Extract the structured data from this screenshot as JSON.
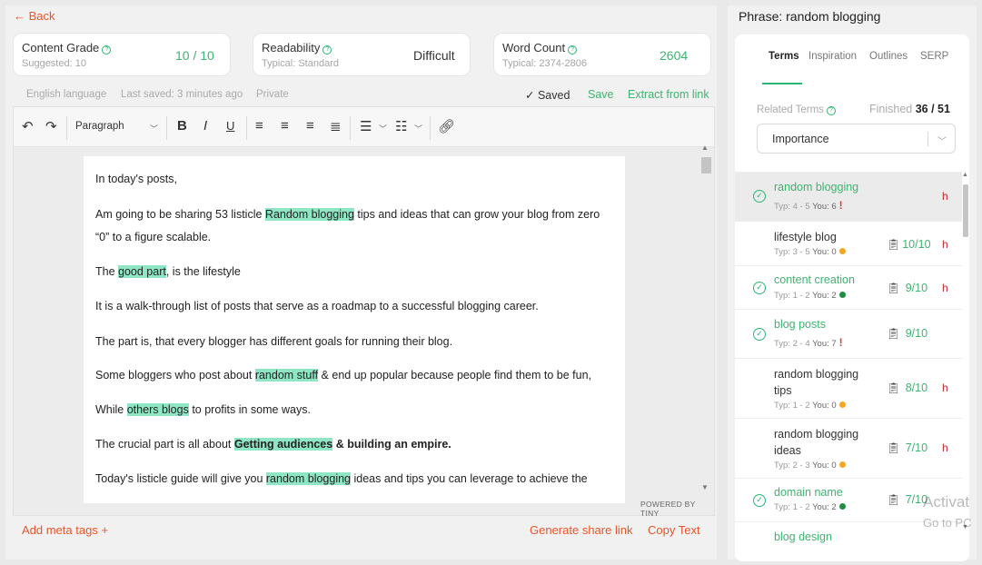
{
  "nav": {
    "back": "← Back"
  },
  "cards": {
    "grade": {
      "title": "Content Grade",
      "sub": "Suggested: 10",
      "value": "10 / 10"
    },
    "readability": {
      "title": "Readability",
      "sub": "Typical: Standard",
      "value": "Difficult"
    },
    "wordcount": {
      "title": "Word Count",
      "sub": "Typical: 2374-2806",
      "value": "2604"
    }
  },
  "status": {
    "language": "English language",
    "saved_time": "Last saved: 3 minutes ago",
    "privacy": "Private",
    "saved": "✓  Saved",
    "save": "Save",
    "extract": "Extract from link"
  },
  "toolbar": {
    "block_format": "Paragraph"
  },
  "editor": {
    "p1": "In today's posts,",
    "p2a": "Am going to be sharing 53 listicle ",
    "p2h": "Random blogging",
    "p2b": " tips and ideas that can grow your blog from zero",
    "p2c": "“0” to a figure scalable.",
    "p3a": "The ",
    "p3h": "good part",
    "p3b": ", is the lifestyle",
    "p4": "It is a walk-through list of posts that serve as a roadmap to a successful blogging career.",
    "p5": "The part is, that every blogger has different goals for running their blog.",
    "p6a": "Some bloggers who post about ",
    "p6h": "random stuff",
    "p6b": " & end up popular because people find them to be fun,",
    "p7a": "While ",
    "p7h": "others blogs",
    "p7b": " to profits in some ways.",
    "p8a": "The crucial part is all about ",
    "p8h": "Getting audiences",
    "p8b": " & building an empire.",
    "p9a": "Today's listicle guide will give you ",
    "p9h": "random blogging",
    "p9b": " ideas and tips you can leverage to achieve the",
    "powered": "POWERED BY TINY"
  },
  "footer": {
    "meta": "Add meta tags +",
    "share": "Generate share link",
    "copy": "Copy Text"
  },
  "right": {
    "phrase": "Phrase: random blogging",
    "tabs": [
      "Terms",
      "Inspiration",
      "Outlines",
      "SERP"
    ],
    "related": "Related Terms",
    "finished_label": "Finished",
    "finished_value": "36 / 51",
    "sort": "Importance"
  },
  "terms": [
    {
      "name": "random blogging",
      "typ": "Typ: 4 - 5",
      "you": "You: 6",
      "score": "",
      "h": "h"
    },
    {
      "name": "lifestyle blog",
      "typ": "Typ: 3 - 5",
      "you": "You: 0",
      "score": "10/10",
      "h": "h"
    },
    {
      "name": "content creation",
      "typ": "Typ: 1 - 2",
      "you": "You: 2",
      "score": "9/10",
      "h": "h"
    },
    {
      "name": "blog posts",
      "typ": "Typ: 2 - 4",
      "you": "You: 7",
      "score": "9/10",
      "h": ""
    },
    {
      "name1": "random blogging",
      "name2": "tips",
      "typ": "Typ: 1 - 2",
      "you": "You: 0",
      "score": "8/10",
      "h": "h"
    },
    {
      "name1": "random blogging",
      "name2": "ideas",
      "typ": "Typ: 2 - 3",
      "you": "You: 0",
      "score": "7/10",
      "h": "h"
    },
    {
      "name": "domain name",
      "typ": "Typ: 1 - 2",
      "you": "You: 2",
      "score": "7/10",
      "h": ""
    },
    {
      "name": "blog design"
    }
  ],
  "watermark": {
    "line1": "Activat",
    "line2": "Go to PC"
  }
}
